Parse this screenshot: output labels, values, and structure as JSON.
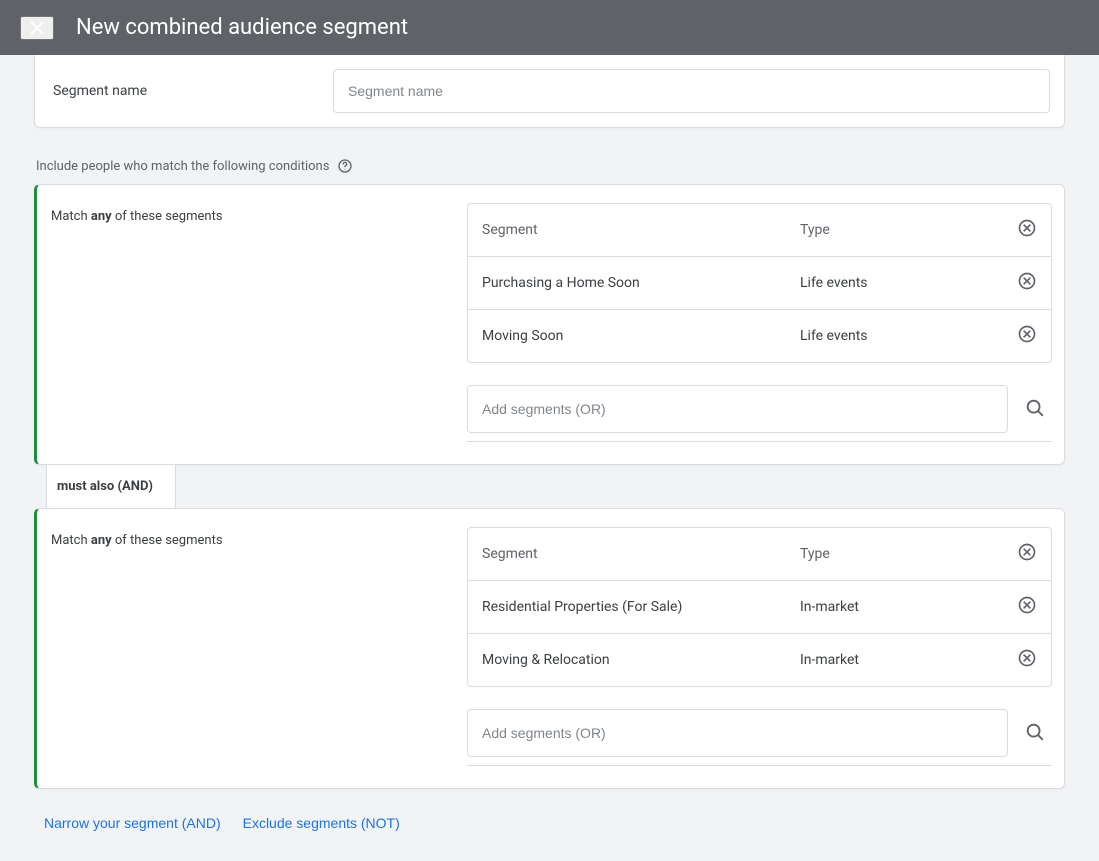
{
  "header": {
    "title": "New combined audience segment"
  },
  "segment_name": {
    "label": "Segment name",
    "placeholder": "Segment name",
    "value": ""
  },
  "intro": {
    "text": "Include people who match the following conditions"
  },
  "groups": [
    {
      "match_prefix": "Match ",
      "match_bold": "any",
      "match_suffix": " of these segments",
      "table_header": {
        "segment": "Segment",
        "type": "Type"
      },
      "rows": [
        {
          "segment": "Purchasing a Home Soon",
          "type": "Life events"
        },
        {
          "segment": "Moving Soon",
          "type": "Life events"
        }
      ],
      "add_placeholder": "Add segments (OR)"
    },
    {
      "match_prefix": "Match ",
      "match_bold": "any",
      "match_suffix": " of these segments",
      "table_header": {
        "segment": "Segment",
        "type": "Type"
      },
      "rows": [
        {
          "segment": "Residential Properties (For Sale)",
          "type": "In-market"
        },
        {
          "segment": "Moving & Relocation",
          "type": "In-market"
        }
      ],
      "add_placeholder": "Add segments (OR)"
    }
  ],
  "connector_label": "must also (AND)",
  "footer": {
    "narrow": "Narrow your segment (AND)",
    "exclude": "Exclude segments (NOT)"
  }
}
